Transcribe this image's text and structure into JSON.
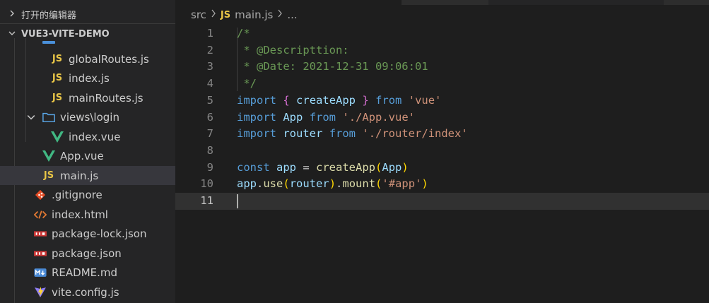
{
  "explorer": {
    "open_editors_label": "打开的编辑器",
    "project_label": "VUE3-VITE-DEMO",
    "items": [
      {
        "label": "globalRoutes.js",
        "icon": "js"
      },
      {
        "label": "index.js",
        "icon": "js"
      },
      {
        "label": "mainRoutes.js",
        "icon": "js"
      },
      {
        "label": "views\\login",
        "icon": "folder"
      },
      {
        "label": "index.vue",
        "icon": "vue"
      },
      {
        "label": "App.vue",
        "icon": "vue"
      },
      {
        "label": "main.js",
        "icon": "js",
        "selected": true
      },
      {
        "label": ".gitignore",
        "icon": "git"
      },
      {
        "label": "index.html",
        "icon": "html"
      },
      {
        "label": "package-lock.json",
        "icon": "npm"
      },
      {
        "label": "package.json",
        "icon": "npm"
      },
      {
        "label": "README.md",
        "icon": "markdown"
      },
      {
        "label": "vite.config.js",
        "icon": "vite"
      }
    ]
  },
  "breadcrumb": {
    "folder": "src",
    "file": "main.js",
    "more": "..."
  },
  "editor": {
    "icon_text": "JS",
    "line_numbers": [
      "1",
      "2",
      "3",
      "4",
      "5",
      "6",
      "7",
      "8",
      "9",
      "10",
      "11"
    ],
    "active_line": "11",
    "lines": [
      "/*",
      " * @Descripttion:",
      " * @Date: 2021-12-31 09:06:01",
      " */",
      "import { createApp } from 'vue'",
      "import App from './App.vue'",
      "import router from './router/index'",
      "",
      "const app = createApp(App)",
      "app.use(router).mount('#app')",
      ""
    ]
  },
  "colors": {
    "keyword": "#569cd6",
    "string": "#ce9178",
    "comment": "#6a9955",
    "function": "#dcdcaa",
    "js_icon": "#e8c547",
    "vue_icon": "#41b883"
  }
}
